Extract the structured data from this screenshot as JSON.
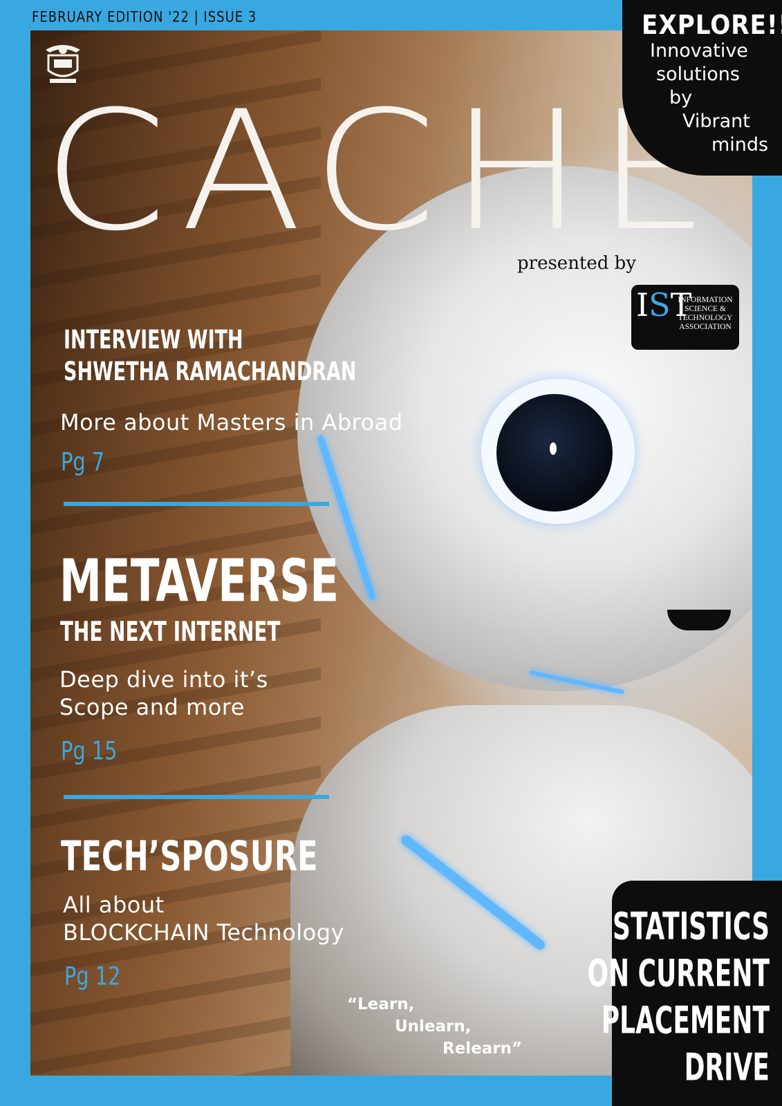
{
  "header": {
    "edition": "FEBRUARY EDITION '22 | ISSUE 3"
  },
  "masthead": {
    "title": "CACHE"
  },
  "explore": {
    "title": "EXPLORE!!",
    "lines": [
      "Innovative",
      "solutions",
      "by",
      "Vibrant",
      "minds"
    ]
  },
  "presenter": {
    "label": "presented by",
    "logo_letters": [
      "I",
      "S",
      "T"
    ],
    "logo_text": [
      "INFORMATION",
      "SCIENCE &",
      "TECHNOLOGY",
      "ASSOCIATION"
    ]
  },
  "features": [
    {
      "title_lines": [
        "INTERVIEW WITH",
        "SHWETHA RAMACHANDRAN"
      ],
      "subtitle_lines": [
        "More about Masters in Abroad"
      ],
      "page": "Pg 7"
    },
    {
      "title_lines": [
        "METAVERSE",
        "THE NEXT INTERNET"
      ],
      "subtitle_lines": [
        "Deep dive into it’s",
        "Scope and more"
      ],
      "page": "Pg 15"
    },
    {
      "title_lines": [
        "TECH’SPOSURE"
      ],
      "subtitle_lines": [
        "All about",
        "BLOCKCHAIN Technology"
      ],
      "page": "Pg 12"
    }
  ],
  "quote": {
    "lines": [
      "“Learn,",
      "Unlearn,",
      "Relearn”"
    ]
  },
  "stats": {
    "lines": [
      "STATISTICS",
      "ON CURRENT",
      "PLACEMENT",
      "DRIVE"
    ]
  },
  "colors": {
    "accent": "#3aa8e0",
    "dark": "#0d0d0d",
    "title": "#f6f3ee"
  }
}
